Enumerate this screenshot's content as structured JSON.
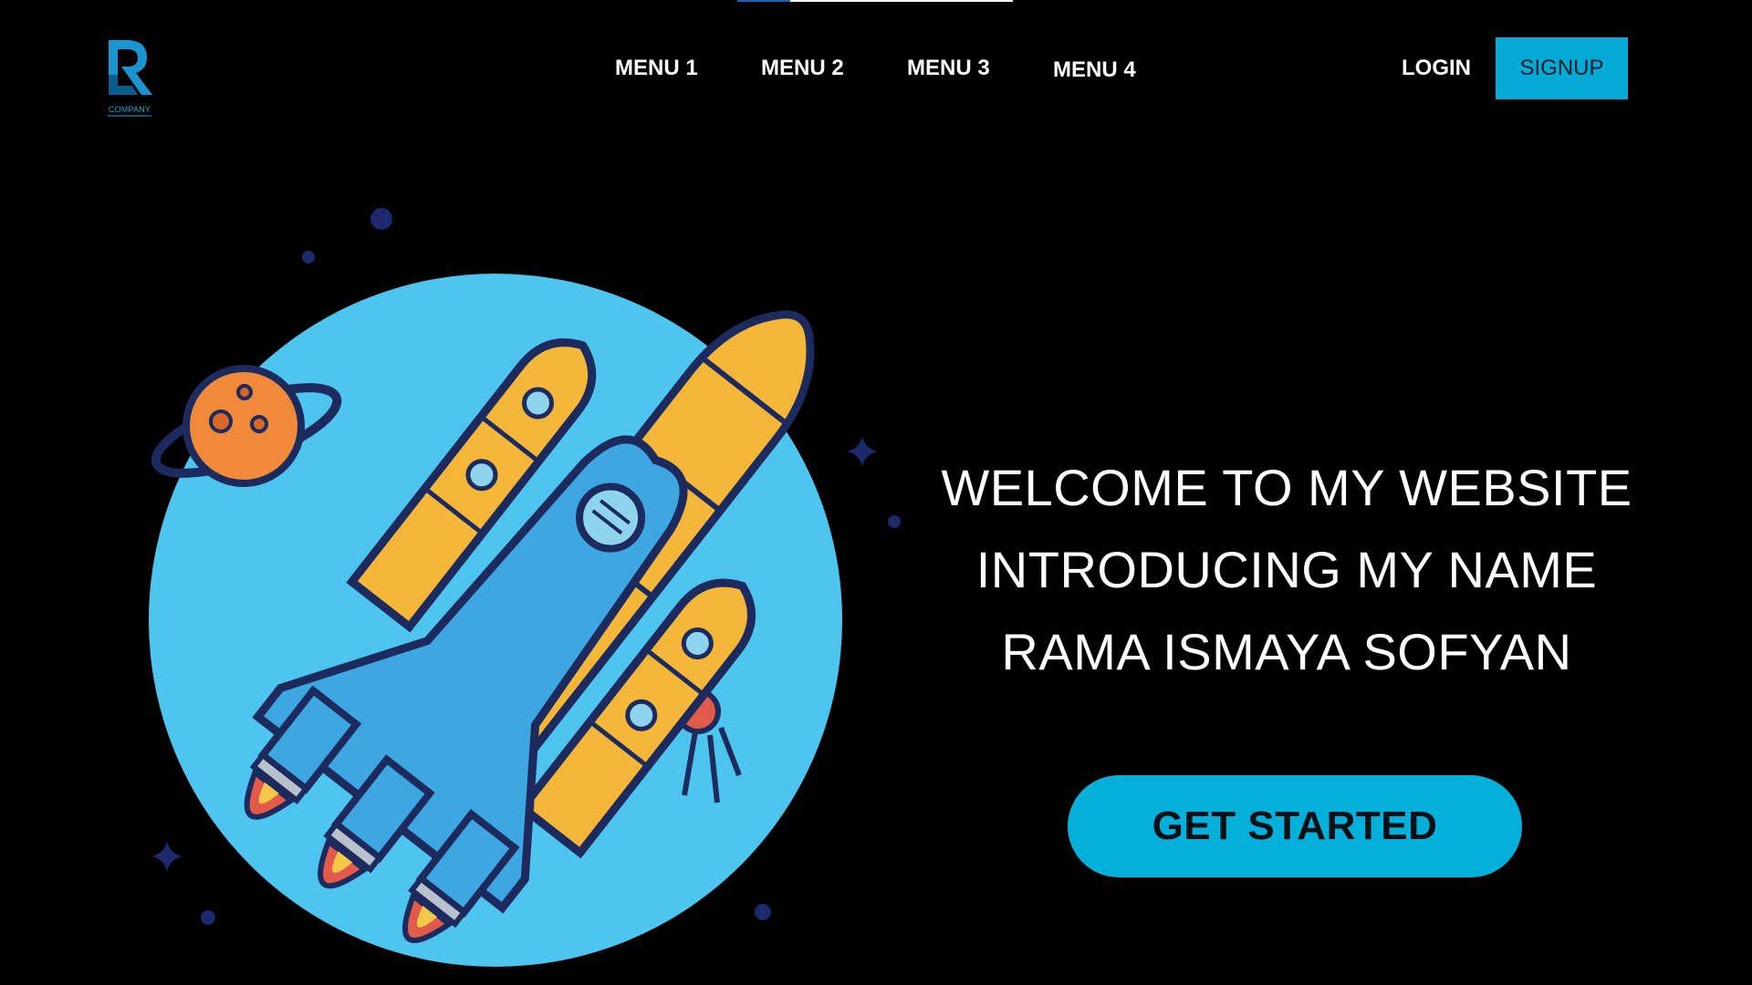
{
  "header": {
    "logo": {
      "brand_name": "COMPANY",
      "icon": "r-letter-logo-icon"
    },
    "nav": [
      {
        "label": "MENU 1"
      },
      {
        "label": "MENU 2"
      },
      {
        "label": "MENU 3"
      },
      {
        "label": "MENU 4"
      }
    ],
    "login_label": "LOGIN",
    "signup_label": "SIGNUP"
  },
  "hero": {
    "lines": [
      "WELCOME TO MY WEBSITE",
      "INTRODUCING MY NAME",
      "RAMA ISMAYA SOFYAN"
    ],
    "cta_label": "GET STARTED",
    "illustration_icon": "rocket-illustration"
  },
  "colors": {
    "background": "#000000",
    "accent": "#04a9d6",
    "circle": "#4ec5ef",
    "rocket_body": "#3ea6e0",
    "boosters": "#f4b73a",
    "outline": "#1c2a5e"
  }
}
